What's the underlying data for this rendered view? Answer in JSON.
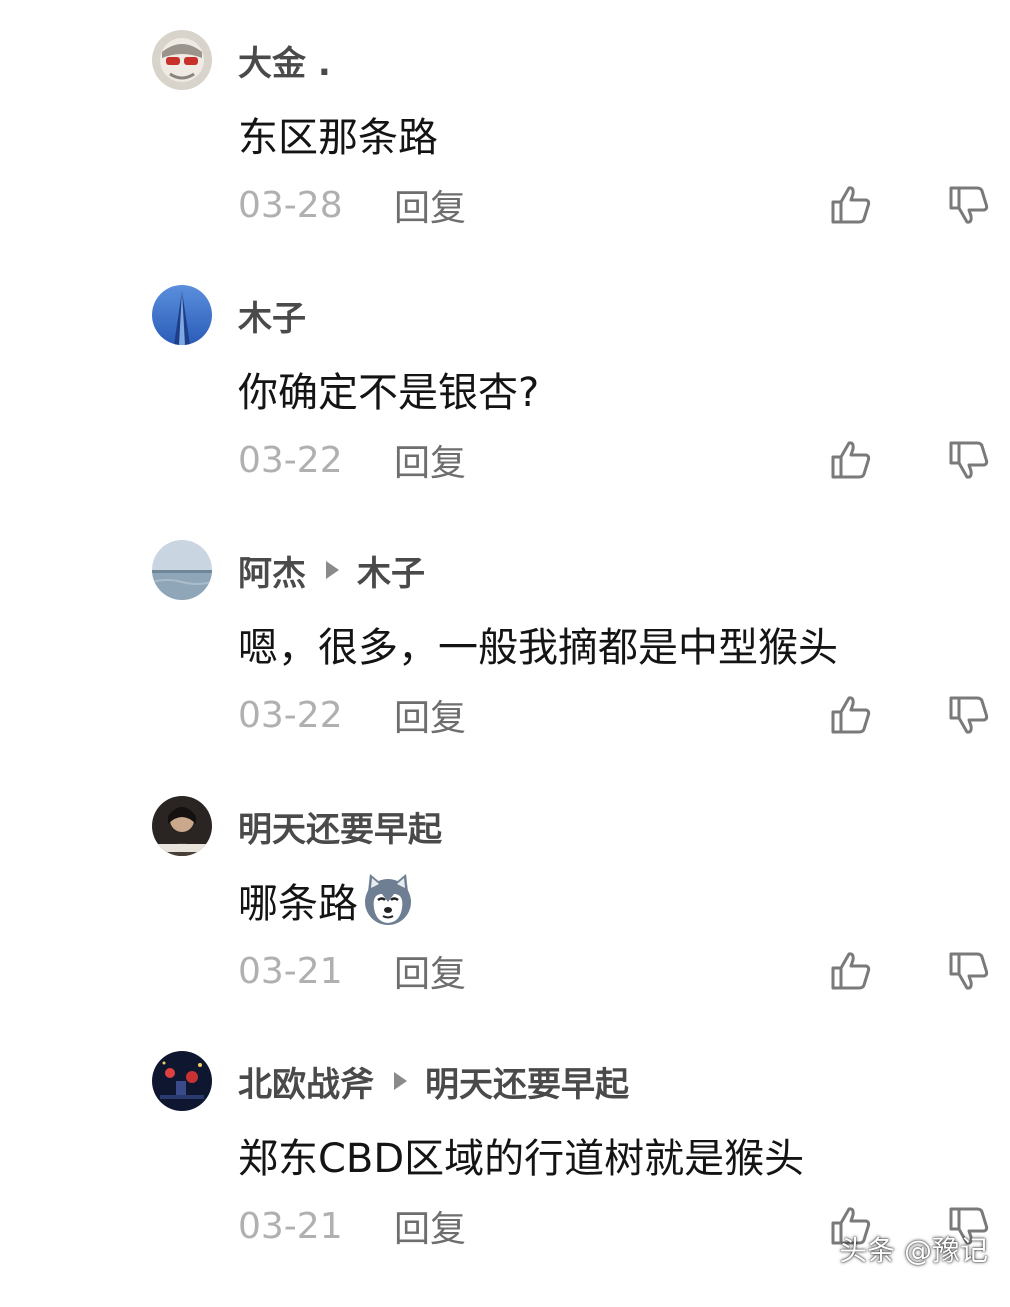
{
  "comments": [
    {
      "user": "大金 .",
      "reply_to": "",
      "text": "东区那条路",
      "date": "03-28",
      "reply_label": "回复",
      "avatar": "red-sunglasses-avatar"
    },
    {
      "user": "木子",
      "reply_to": "",
      "text": "你确定不是银杏?",
      "date": "03-22",
      "reply_label": "回复",
      "avatar": "blue-tower-avatar"
    },
    {
      "user": "阿杰",
      "reply_to": "木子",
      "text": "嗯，很多，一般我摘都是中型猴头",
      "date": "03-22",
      "reply_label": "回复",
      "avatar": "sea-horizon-avatar"
    },
    {
      "user": "明天还要早起",
      "reply_to": "",
      "text": "哪条路",
      "date": "03-21",
      "reply_label": "回复",
      "avatar": "dark-portrait-avatar",
      "emoji": "husky-dog-emoji"
    },
    {
      "user": "北欧战斧",
      "reply_to": "明天还要早起",
      "text": "郑东CBD区域的行道树就是猴头",
      "date": "03-21",
      "reply_label": "回复",
      "avatar": "night-city-avatar"
    }
  ],
  "icons": {
    "like": "thumbs-up-icon",
    "dislike": "thumbs-down-icon"
  },
  "colors": {
    "username": "#4a4a4a",
    "body": "#141414",
    "date": "#b0b0b0",
    "reply": "#6e6e6e",
    "icon": "#7a7a7a"
  },
  "watermark": "头条 @豫记"
}
